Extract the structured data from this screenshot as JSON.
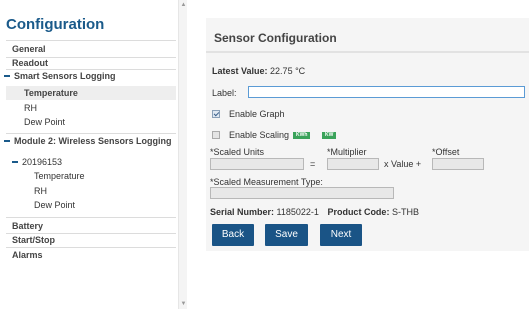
{
  "sidebar": {
    "title": "Configuration",
    "items": {
      "general": "General",
      "readout": "Readout",
      "smart_sensors": "Smart Sensors Logging",
      "temperature": "Temperature",
      "rh": "RH",
      "dew_point": "Dew Point",
      "module2": "Module 2: Wireless Sensors Logging",
      "sensor_id": "20196153",
      "sub_temperature": "Temperature",
      "sub_rh": "RH",
      "sub_dew_point": "Dew Point",
      "battery": "Battery",
      "start_stop": "Start/Stop",
      "alarms": "Alarms"
    }
  },
  "scrollbar": {
    "up": "▲",
    "down": "▼"
  },
  "panel": {
    "title": "Sensor Configuration",
    "latest_value_label": "Latest Value:",
    "latest_value": "22.75 °C",
    "label_label": "Label:",
    "label_value": "",
    "enable_graph": "Enable Graph",
    "enable_scaling": "Enable Scaling",
    "tag1": "KWh",
    "tag2": "KW",
    "scaled_units": "*Scaled Units",
    "multiplier": "*Multiplier",
    "offset": "*Offset",
    "equals": "=",
    "x_value_plus": "x Value +",
    "scaled_measurement_type": "*Scaled Measurement Type:",
    "serial_number_label": "Serial Number:",
    "serial_number": "1185022-1",
    "product_code_label": "Product Code:",
    "product_code": "S-THB",
    "back": "Back",
    "save": "Save",
    "next": "Next"
  },
  "colors": {
    "accent": "#1a5486",
    "title": "#1a5a8a",
    "tag": "#3aa35a"
  }
}
